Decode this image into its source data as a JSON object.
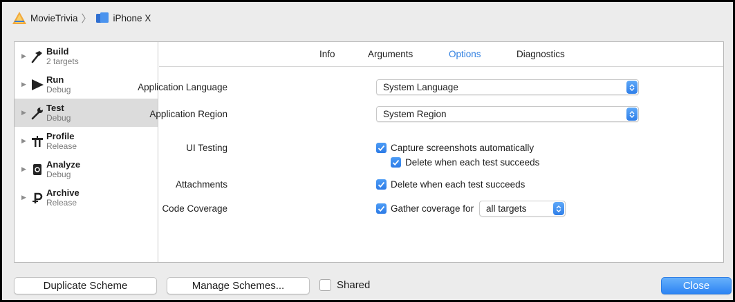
{
  "breadcrumb": {
    "project": "MovieTrivia",
    "device": "iPhone X"
  },
  "sidebar": {
    "items": [
      {
        "title": "Build",
        "subtitle": "2 targets",
        "icon": "hammer-icon"
      },
      {
        "title": "Run",
        "subtitle": "Debug",
        "icon": "play-icon"
      },
      {
        "title": "Test",
        "subtitle": "Debug",
        "icon": "wrench-icon",
        "selected": true
      },
      {
        "title": "Profile",
        "subtitle": "Release",
        "icon": "profile-icon"
      },
      {
        "title": "Analyze",
        "subtitle": "Debug",
        "icon": "analyze-icon"
      },
      {
        "title": "Archive",
        "subtitle": "Release",
        "icon": "archive-icon"
      }
    ]
  },
  "tabs": [
    {
      "label": "Info"
    },
    {
      "label": "Arguments"
    },
    {
      "label": "Options",
      "active": true
    },
    {
      "label": "Diagnostics"
    }
  ],
  "options": {
    "app_language_label": "Application Language",
    "app_language_value": "System Language",
    "app_region_label": "Application Region",
    "app_region_value": "System Region",
    "ui_testing_label": "UI Testing",
    "capture_screenshots": "Capture screenshots automatically",
    "delete_on_success": "Delete when each test succeeds",
    "attachments_label": "Attachments",
    "attachments_delete": "Delete when each test succeeds",
    "code_coverage_label": "Code Coverage",
    "gather_coverage": "Gather coverage for",
    "coverage_targets": "all targets"
  },
  "footer": {
    "duplicate_label": "Duplicate Scheme",
    "manage_label": "Manage Schemes...",
    "shared_label": "Shared",
    "close_label": "Close"
  },
  "colors": {
    "accent": "#2f7fe0",
    "selected_row": "#dcdcdc",
    "window_bg": "#ececec"
  }
}
